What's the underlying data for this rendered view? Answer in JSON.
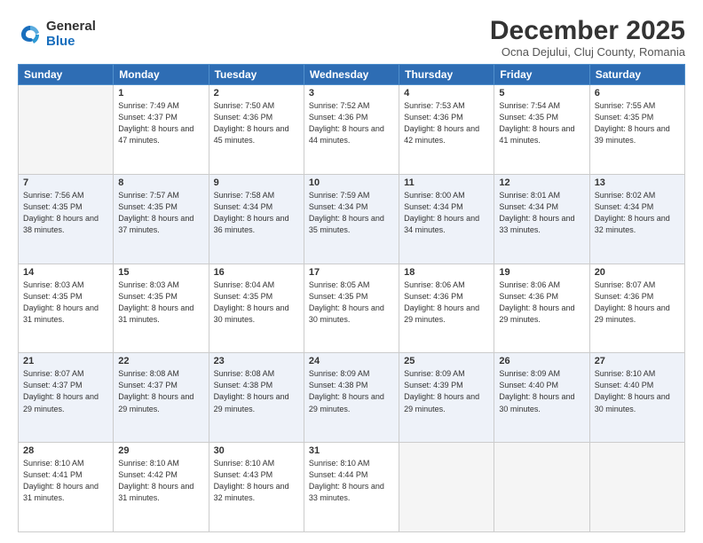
{
  "logo": {
    "general": "General",
    "blue": "Blue"
  },
  "title": "December 2025",
  "location": "Ocna Dejului, Cluj County, Romania",
  "days_of_week": [
    "Sunday",
    "Monday",
    "Tuesday",
    "Wednesday",
    "Thursday",
    "Friday",
    "Saturday"
  ],
  "weeks": [
    [
      {
        "day": "",
        "empty": true
      },
      {
        "day": "1",
        "sunrise": "7:49 AM",
        "sunset": "4:37 PM",
        "daylight": "8 hours and 47 minutes."
      },
      {
        "day": "2",
        "sunrise": "7:50 AM",
        "sunset": "4:36 PM",
        "daylight": "8 hours and 45 minutes."
      },
      {
        "day": "3",
        "sunrise": "7:52 AM",
        "sunset": "4:36 PM",
        "daylight": "8 hours and 44 minutes."
      },
      {
        "day": "4",
        "sunrise": "7:53 AM",
        "sunset": "4:36 PM",
        "daylight": "8 hours and 42 minutes."
      },
      {
        "day": "5",
        "sunrise": "7:54 AM",
        "sunset": "4:35 PM",
        "daylight": "8 hours and 41 minutes."
      },
      {
        "day": "6",
        "sunrise": "7:55 AM",
        "sunset": "4:35 PM",
        "daylight": "8 hours and 39 minutes."
      }
    ],
    [
      {
        "day": "7",
        "sunrise": "7:56 AM",
        "sunset": "4:35 PM",
        "daylight": "8 hours and 38 minutes."
      },
      {
        "day": "8",
        "sunrise": "7:57 AM",
        "sunset": "4:35 PM",
        "daylight": "8 hours and 37 minutes."
      },
      {
        "day": "9",
        "sunrise": "7:58 AM",
        "sunset": "4:34 PM",
        "daylight": "8 hours and 36 minutes."
      },
      {
        "day": "10",
        "sunrise": "7:59 AM",
        "sunset": "4:34 PM",
        "daylight": "8 hours and 35 minutes."
      },
      {
        "day": "11",
        "sunrise": "8:00 AM",
        "sunset": "4:34 PM",
        "daylight": "8 hours and 34 minutes."
      },
      {
        "day": "12",
        "sunrise": "8:01 AM",
        "sunset": "4:34 PM",
        "daylight": "8 hours and 33 minutes."
      },
      {
        "day": "13",
        "sunrise": "8:02 AM",
        "sunset": "4:34 PM",
        "daylight": "8 hours and 32 minutes."
      }
    ],
    [
      {
        "day": "14",
        "sunrise": "8:03 AM",
        "sunset": "4:35 PM",
        "daylight": "8 hours and 31 minutes."
      },
      {
        "day": "15",
        "sunrise": "8:03 AM",
        "sunset": "4:35 PM",
        "daylight": "8 hours and 31 minutes."
      },
      {
        "day": "16",
        "sunrise": "8:04 AM",
        "sunset": "4:35 PM",
        "daylight": "8 hours and 30 minutes."
      },
      {
        "day": "17",
        "sunrise": "8:05 AM",
        "sunset": "4:35 PM",
        "daylight": "8 hours and 30 minutes."
      },
      {
        "day": "18",
        "sunrise": "8:06 AM",
        "sunset": "4:36 PM",
        "daylight": "8 hours and 29 minutes."
      },
      {
        "day": "19",
        "sunrise": "8:06 AM",
        "sunset": "4:36 PM",
        "daylight": "8 hours and 29 minutes."
      },
      {
        "day": "20",
        "sunrise": "8:07 AM",
        "sunset": "4:36 PM",
        "daylight": "8 hours and 29 minutes."
      }
    ],
    [
      {
        "day": "21",
        "sunrise": "8:07 AM",
        "sunset": "4:37 PM",
        "daylight": "8 hours and 29 minutes."
      },
      {
        "day": "22",
        "sunrise": "8:08 AM",
        "sunset": "4:37 PM",
        "daylight": "8 hours and 29 minutes."
      },
      {
        "day": "23",
        "sunrise": "8:08 AM",
        "sunset": "4:38 PM",
        "daylight": "8 hours and 29 minutes."
      },
      {
        "day": "24",
        "sunrise": "8:09 AM",
        "sunset": "4:38 PM",
        "daylight": "8 hours and 29 minutes."
      },
      {
        "day": "25",
        "sunrise": "8:09 AM",
        "sunset": "4:39 PM",
        "daylight": "8 hours and 29 minutes."
      },
      {
        "day": "26",
        "sunrise": "8:09 AM",
        "sunset": "4:40 PM",
        "daylight": "8 hours and 30 minutes."
      },
      {
        "day": "27",
        "sunrise": "8:10 AM",
        "sunset": "4:40 PM",
        "daylight": "8 hours and 30 minutes."
      }
    ],
    [
      {
        "day": "28",
        "sunrise": "8:10 AM",
        "sunset": "4:41 PM",
        "daylight": "8 hours and 31 minutes."
      },
      {
        "day": "29",
        "sunrise": "8:10 AM",
        "sunset": "4:42 PM",
        "daylight": "8 hours and 31 minutes."
      },
      {
        "day": "30",
        "sunrise": "8:10 AM",
        "sunset": "4:43 PM",
        "daylight": "8 hours and 32 minutes."
      },
      {
        "day": "31",
        "sunrise": "8:10 AM",
        "sunset": "4:44 PM",
        "daylight": "8 hours and 33 minutes."
      },
      {
        "day": "",
        "empty": true
      },
      {
        "day": "",
        "empty": true
      },
      {
        "day": "",
        "empty": true
      }
    ]
  ]
}
